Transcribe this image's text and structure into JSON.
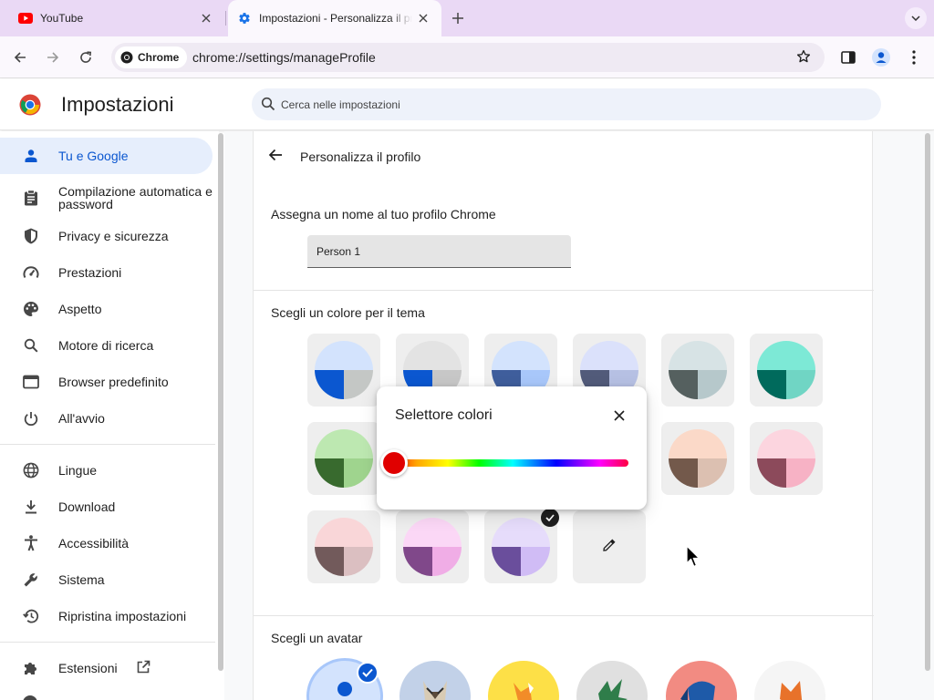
{
  "tabs": [
    {
      "title": "YouTube",
      "favicon": "youtube-icon"
    },
    {
      "title": "Impostazioni - Personalizza il profilo",
      "favicon": "gear-icon"
    }
  ],
  "toolbar": {
    "chip_label": "Chrome",
    "url_host": "chrome://settings",
    "url_path": "/manageProfile"
  },
  "header": {
    "title": "Impostazioni",
    "search_placeholder": "Cerca nelle impostazioni"
  },
  "sidebar": {
    "items": [
      {
        "label": "Tu e Google",
        "icon": "person-icon",
        "active": true
      },
      {
        "label": "Compilazione automatica e password",
        "icon": "clipboard-icon"
      },
      {
        "label": "Privacy e sicurezza",
        "icon": "shield-icon"
      },
      {
        "label": "Prestazioni",
        "icon": "speedometer-icon"
      },
      {
        "label": "Aspetto",
        "icon": "palette-icon"
      },
      {
        "label": "Motore di ricerca",
        "icon": "search-icon"
      },
      {
        "label": "Browser predefinito",
        "icon": "browser-icon"
      },
      {
        "label": "All'avvio",
        "icon": "power-icon"
      },
      {
        "label": "Lingue",
        "icon": "globe-icon"
      },
      {
        "label": "Download",
        "icon": "download-icon"
      },
      {
        "label": "Accessibilità",
        "icon": "accessibility-icon"
      },
      {
        "label": "Sistema",
        "icon": "wrench-icon"
      },
      {
        "label": "Ripristina impostazioni",
        "icon": "restore-icon"
      },
      {
        "label": "Estensioni",
        "icon": "puzzle-icon"
      }
    ]
  },
  "main": {
    "page_title": "Personalizza il profilo",
    "name_section_label": "Assegna un nome al tuo profilo Chrome",
    "profile_name": "Person 1",
    "color_section_label": "Scegli un colore per il tema",
    "avatar_section_label": "Scegli un avatar"
  },
  "color_picker": {
    "title": "Selettore colori",
    "hue_percent": 0,
    "selected_color": "#e00000"
  },
  "colors": {
    "accent": "#0b57d0",
    "active_nav_bg": "#e6eefc",
    "tabstrip_bg": "#ead9f5"
  }
}
